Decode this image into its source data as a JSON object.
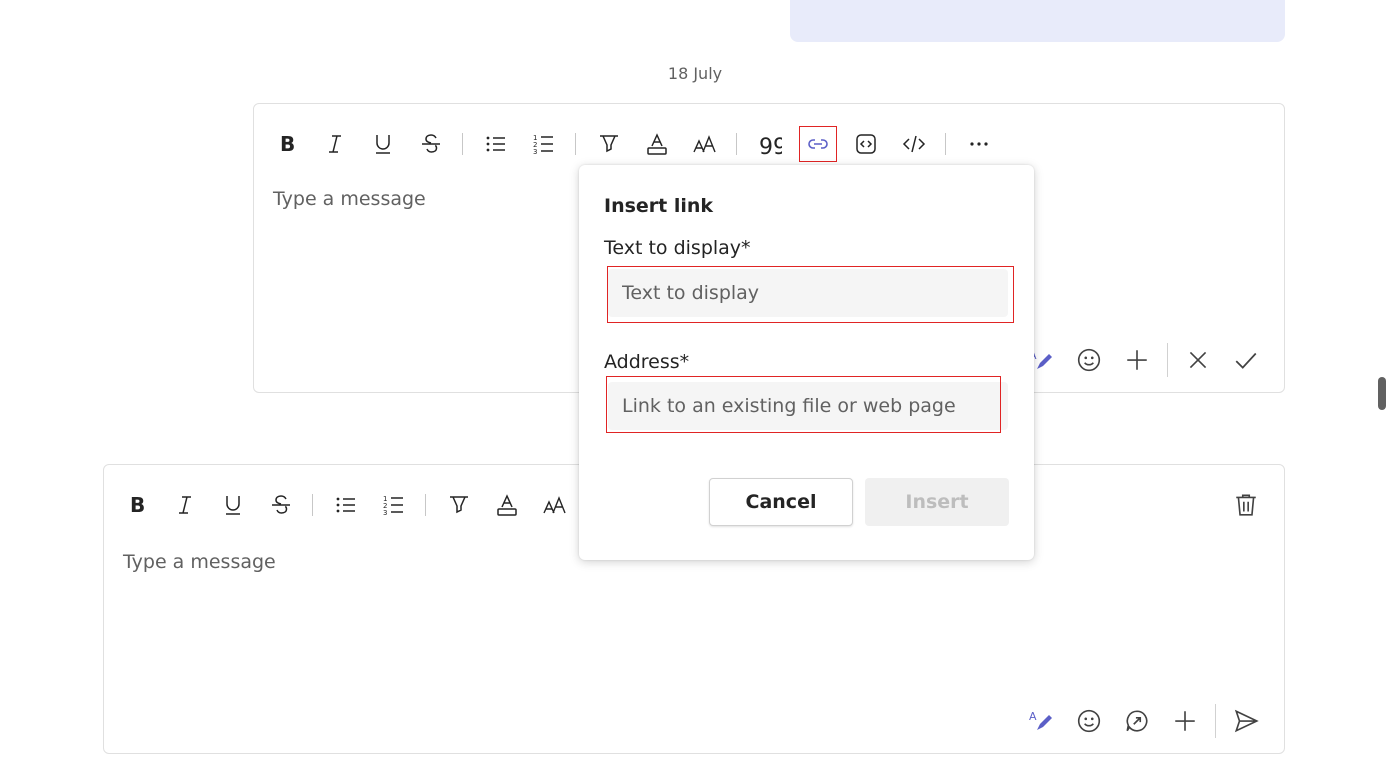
{
  "date_divider": "18 July",
  "composer_top": {
    "placeholder": "Type a message",
    "toolbar": [
      "bold-icon",
      "italic-icon",
      "underline-icon",
      "strikethrough-icon",
      "bullet-list-icon",
      "numbered-list-icon",
      "highlight-icon",
      "font-color-icon",
      "font-size-icon",
      "quote-icon",
      "link-icon",
      "code-snippet-icon",
      "code-icon",
      "more-icon"
    ],
    "bottom": [
      "rewrite-icon",
      "emoji-icon",
      "add-icon",
      "discard-icon",
      "done-icon"
    ]
  },
  "composer_bottom": {
    "placeholder": "Type a message",
    "toolbar": [
      "bold-icon",
      "italic-icon",
      "underline-icon",
      "strikethrough-icon",
      "bullet-list-icon",
      "numbered-list-icon",
      "highlight-icon",
      "font-color-icon",
      "font-size-icon"
    ],
    "bottom": [
      "rewrite-icon",
      "emoji-icon",
      "loop-icon",
      "add-icon",
      "send-icon"
    ]
  },
  "insert_link_dialog": {
    "title": "Insert link",
    "text_label": "Text to display*",
    "text_placeholder": "Text to display",
    "text_value": "",
    "address_label": "Address*",
    "address_placeholder": "Link to an existing file or web page",
    "address_value": "",
    "cancel_label": "Cancel",
    "insert_label": "Insert",
    "insert_enabled": false
  },
  "colors": {
    "accent": "#5b5fc7",
    "highlight_box": "#e02424",
    "bubble": "#e8ebfa"
  }
}
